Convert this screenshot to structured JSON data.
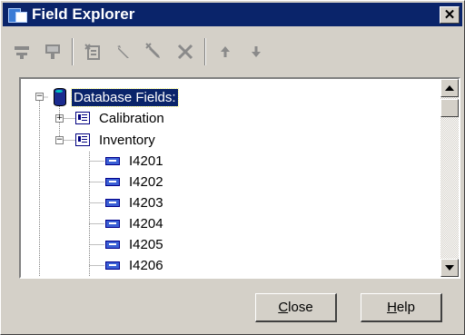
{
  "window": {
    "title": "Field Explorer",
    "close_glyph": "✕"
  },
  "toolbar": {
    "icons": [
      "filter-icon",
      "filter-edit-icon",
      "new-item-icon",
      "edit-pencil-icon",
      "rename-icon",
      "delete-icon",
      "move-up-icon",
      "move-down-icon"
    ]
  },
  "tree": {
    "root": {
      "label": "Database Fields:",
      "expanded": true,
      "selected": true
    },
    "groups": [
      {
        "label": "Calibration",
        "expanded": false,
        "children": []
      },
      {
        "label": "Inventory",
        "expanded": true,
        "children": [
          "I4201",
          "I4202",
          "I4203",
          "I4204",
          "I4205",
          "I4206"
        ]
      }
    ]
  },
  "buttons": {
    "close": {
      "mnemonic": "C",
      "rest": "lose"
    },
    "help": {
      "mnemonic": "H",
      "rest": "elp"
    }
  },
  "colors": {
    "titlebar": "#0a246a",
    "face": "#d4d0c8",
    "selection": "#0a246a",
    "disabled_icon": "#8a8a8a"
  }
}
